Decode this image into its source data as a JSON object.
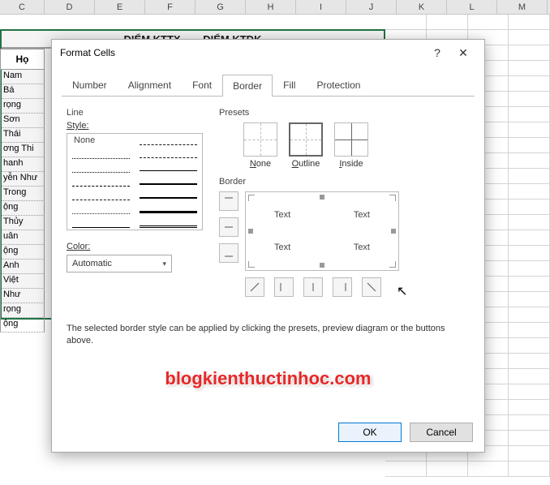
{
  "columns": [
    "C",
    "D",
    "E",
    "F",
    "G",
    "H",
    "I",
    "J",
    "K",
    "L",
    "M"
  ],
  "merged_headers": {
    "a": "ĐIỂM KTTX",
    "b": "ĐIỂM KTĐK"
  },
  "name_header": "Họ",
  "names": [
    "Nam",
    "Bá",
    "rọng",
    "Sơn",
    "Thái",
    "ơng Thi",
    "hanh",
    "yễn Như",
    "Trong",
    "ộng",
    "Thủy",
    "uân",
    "ộng",
    "Anh",
    "Việt",
    "Như",
    "rọng",
    "ộng"
  ],
  "dialog": {
    "title": "Format Cells",
    "tabs": [
      "Number",
      "Alignment",
      "Font",
      "Border",
      "Fill",
      "Protection"
    ],
    "active_tab": "Border",
    "line_group": "Line",
    "style_label": "Style:",
    "style_none": "None",
    "color_label": "Color:",
    "color_value": "Automatic",
    "presets_group": "Presets",
    "preset_none": "None",
    "preset_none_u": "N",
    "preset_outline": "Outline",
    "preset_outline_u": "O",
    "preset_inside": "Inside",
    "preset_inside_u": "I",
    "border_group": "Border",
    "preview_text": "Text",
    "help": "The selected border style can be applied by clicking the presets, preview diagram or the buttons above.",
    "ok": "OK",
    "cancel": "Cancel"
  },
  "watermark": "blogkienthuctinhoc.com"
}
